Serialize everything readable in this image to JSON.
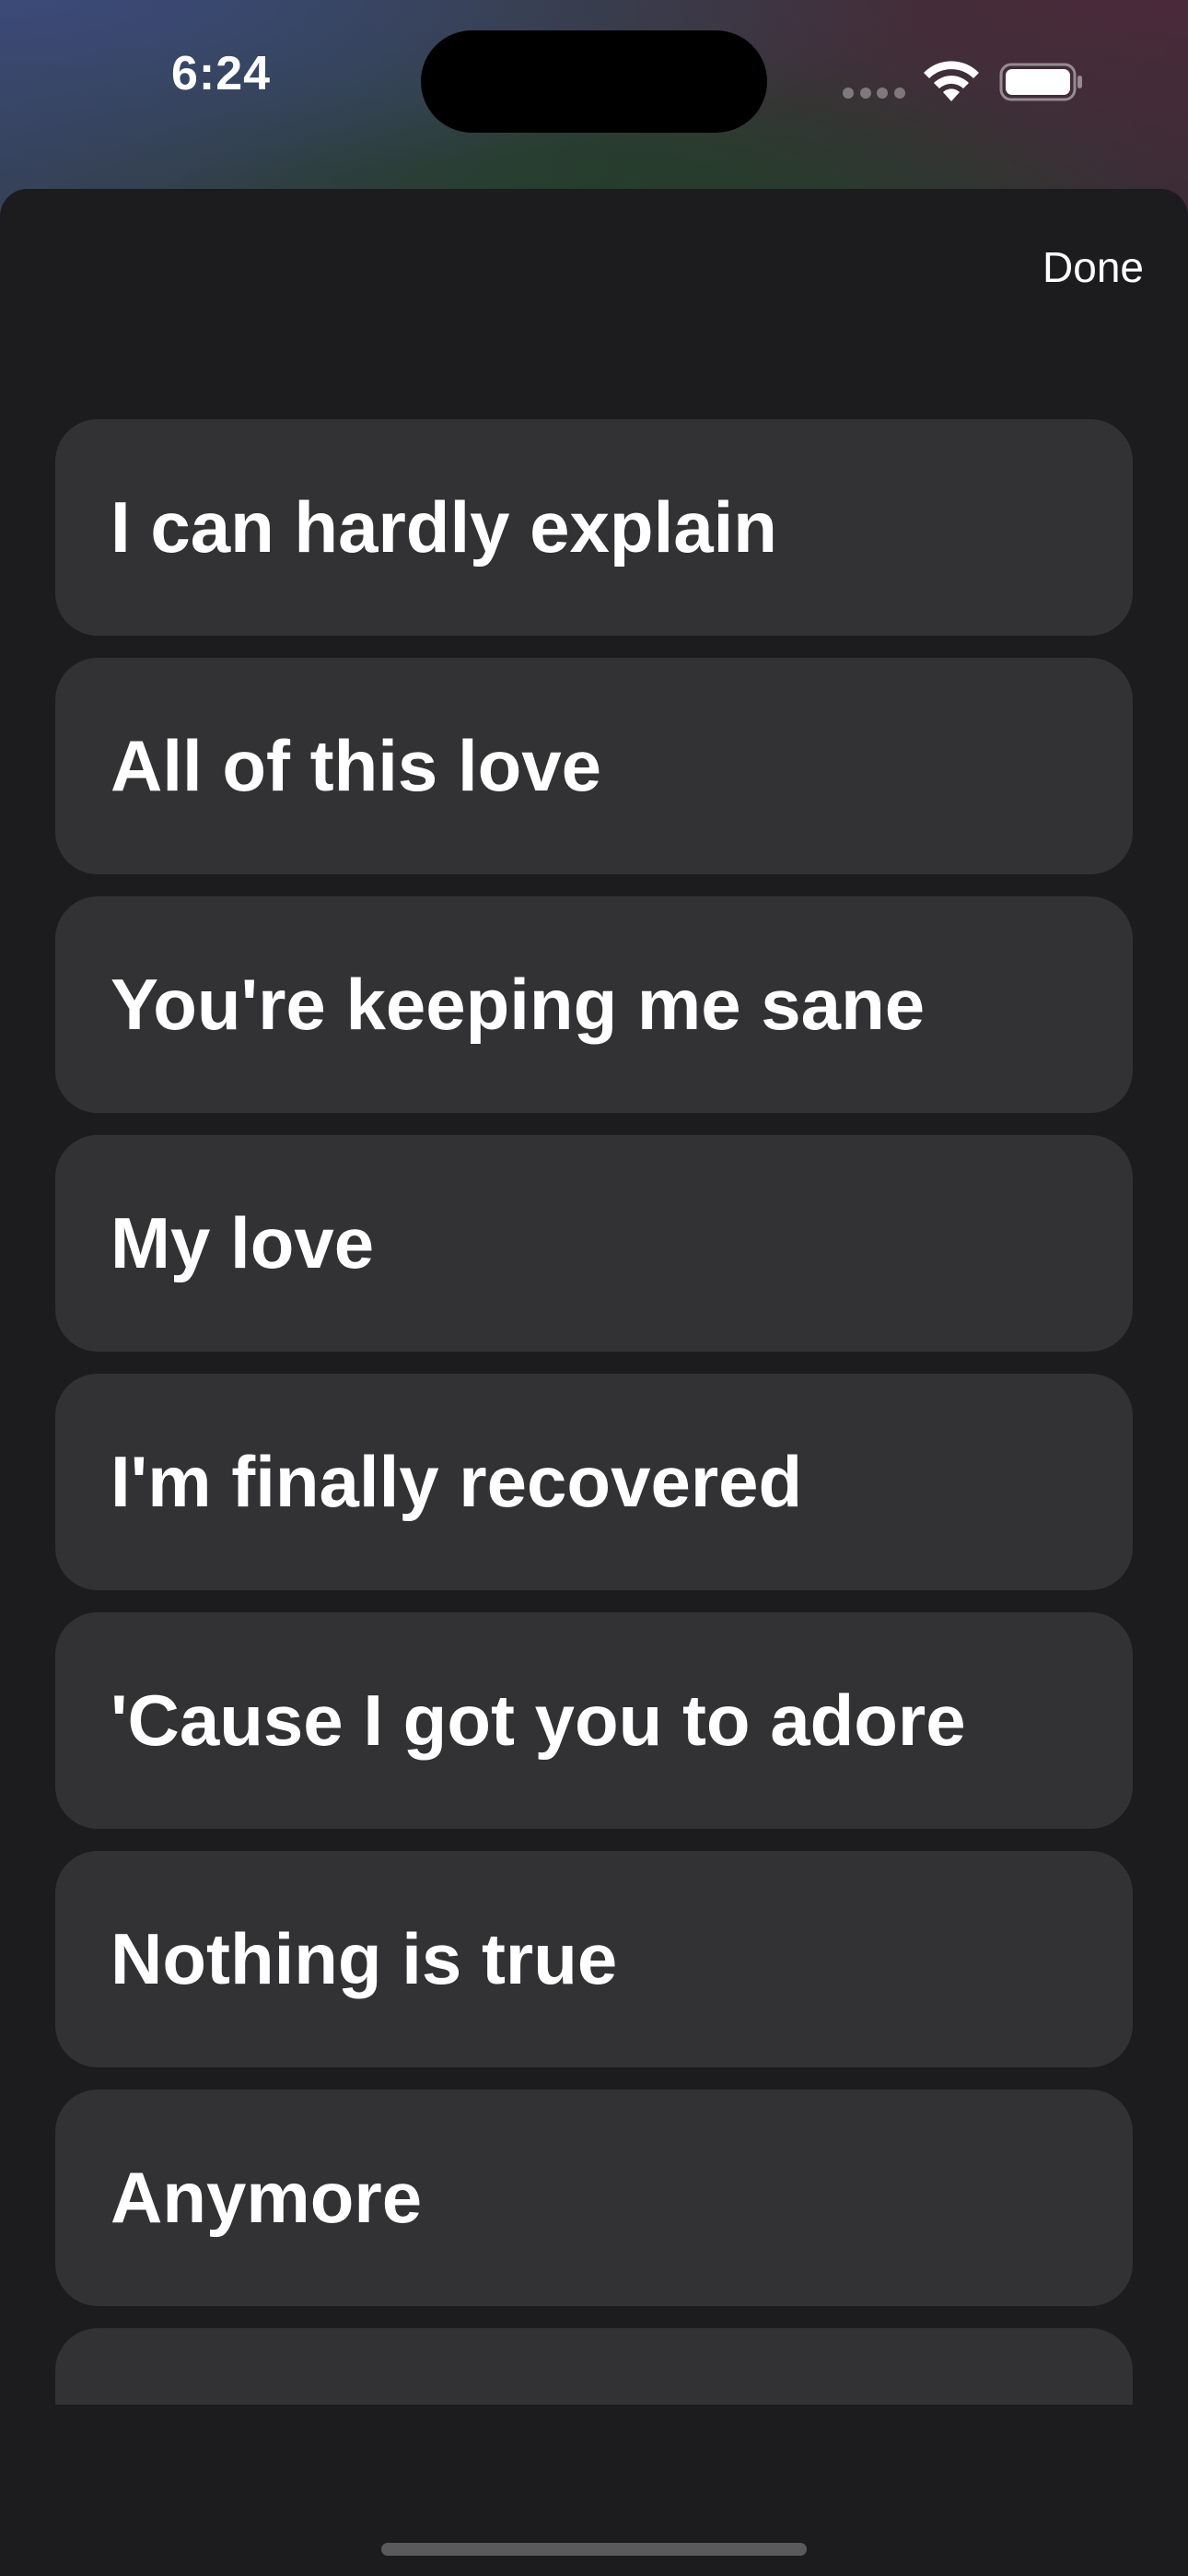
{
  "status_bar": {
    "time": "6:24",
    "icons": [
      "cellular-signal-icon",
      "wifi-icon",
      "battery-icon"
    ]
  },
  "sheet": {
    "done_label": "Done"
  },
  "lyrics": [
    "I can hardly explain",
    "All of this love",
    "You're keeping me sane",
    "My love",
    "I'm finally recovered",
    "'Cause I got you to adore",
    "Nothing is true",
    "Anymore",
    ""
  ],
  "colors": {
    "sheet_background": "#1c1c1e",
    "row_background": "#323234",
    "text": "#ffffff"
  }
}
